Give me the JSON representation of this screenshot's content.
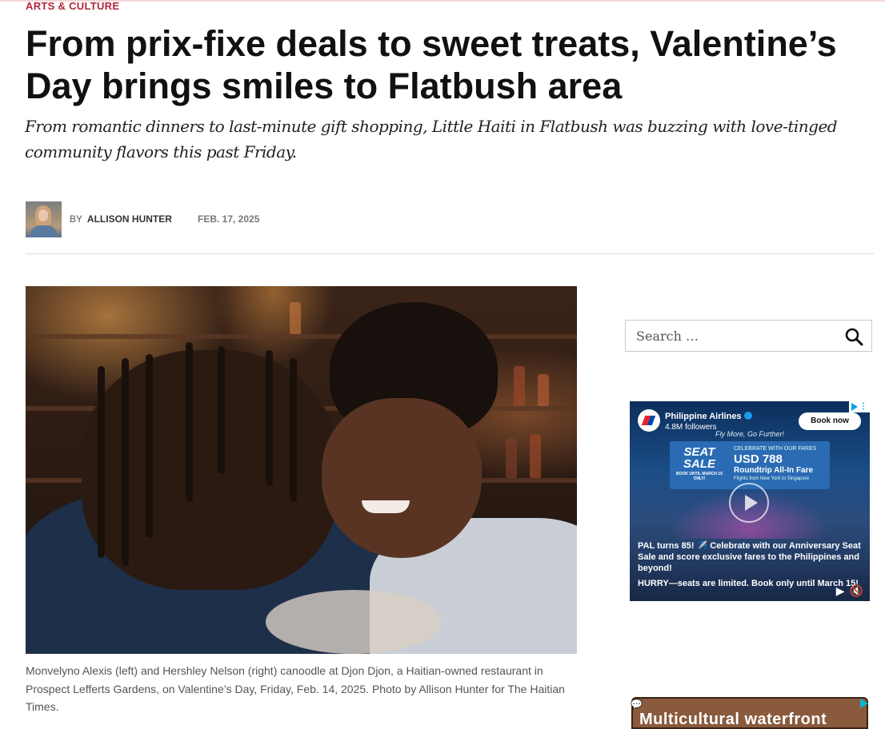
{
  "article": {
    "category": "Arts & Culture",
    "headline": "From prix-fixe deals to sweet treats, Valentine’s Day brings smiles to Flatbush area",
    "dek": "From romantic dinners to last-minute gift shopping, Little Haiti in Flatbush was buzzing with love-tinged community flavors this past Friday.",
    "byline_prefix": "By",
    "author": "Allison Hunter",
    "date": "Feb. 17, 2025",
    "caption": "Monvelyno Alexis (left) and Hershley Nelson (right) canoodle at Djon Djon, a Haitian-owned restaurant in Prospect Lefferts Gardens, on Valentine’s Day, Friday, Feb. 14, 2025. Photo by Allison Hunter for The Haitian Times."
  },
  "sidebar": {
    "search": {
      "placeholder": "Search …",
      "icon": "search-icon"
    }
  },
  "ads": {
    "airline": {
      "advertiser": "Philippine Airlines",
      "followers": "4.8M followers",
      "cta": "Book now",
      "tagline": "Fly More, Go Further!",
      "card": {
        "headline": "SEAT SALE",
        "book_until": "BOOK UNTIL MARCH 15 ONLY!",
        "label": "CELEBRATE WITH OUR FARES",
        "price": "USD 788",
        "fare_type": "Roundtrip All-In Fare",
        "route": "Flights from New York to Singapore"
      },
      "body": "PAL turns 85! ✈️ Celebrate with our Anniversary Seat Sale and score exclusive fares to the Philippines and beyond!",
      "body2": "HURRY—seats are limited. Book only until March 15!",
      "accent": "#1b4d86"
    },
    "banner": {
      "text": "Multicultural waterfront"
    }
  },
  "colors": {
    "category": "#b0263a",
    "divider": "#dddddd",
    "caption": "#555555"
  }
}
